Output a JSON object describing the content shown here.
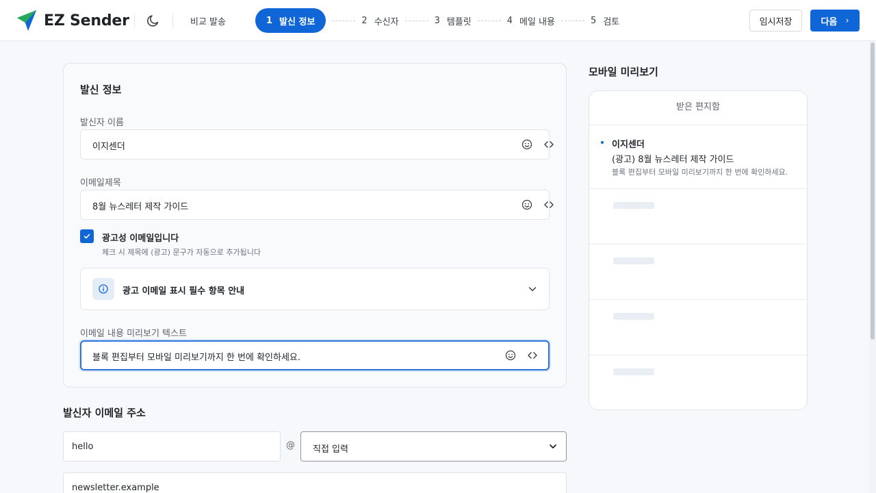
{
  "app": {
    "name": "EZ Sender"
  },
  "header": {
    "compare_label": "비교 발송",
    "steps": [
      {
        "num": "1",
        "label": "발신 정보"
      },
      {
        "num": "2",
        "label": "수신자"
      },
      {
        "num": "3",
        "label": "템플릿"
      },
      {
        "num": "4",
        "label": "메일 내용"
      },
      {
        "num": "5",
        "label": "검토"
      }
    ],
    "active_step": 1,
    "save_label": "임시저장",
    "next_label": "다음"
  },
  "sender_info": {
    "title": "발신 정보",
    "sender_name": {
      "label": "발신자 이름",
      "value": "이지센더"
    },
    "subject": {
      "label": "이메일제목",
      "value": "8월 뉴스레터 제작 가이드"
    },
    "ad_checkbox": {
      "checked": true,
      "label": "광고성 이메일입니다",
      "description": "체크 시 제목에 (광고) 문구가 자동으로 추가됩니다"
    },
    "ad_notice": {
      "label": "광고 이메일 표시 필수 항목 안내"
    },
    "preheader": {
      "label": "이메일 내용 미리보기 텍스트",
      "value": "블록 편집부터 모바일 미리보기까지 한 번에 확인하세요."
    }
  },
  "sender_email": {
    "title": "발신자 이메일 주소",
    "local_part": "hello",
    "at": "@",
    "domain_select": "직접 입력",
    "domain_value": "newsletter.example"
  },
  "preview": {
    "title": "모바일 미리보기",
    "inbox_label": "받은 편지함",
    "mail": {
      "sender": "이지센더",
      "subject": "(광고) 8월 뉴스레터 제작 가이드",
      "preheader": "블록 편집부터 모바일 미리보기까지 한 번에 확인하세요."
    }
  },
  "colors": {
    "accent": "#1066d6",
    "border": "#e1e5ea",
    "background": "#f6f8fb"
  }
}
